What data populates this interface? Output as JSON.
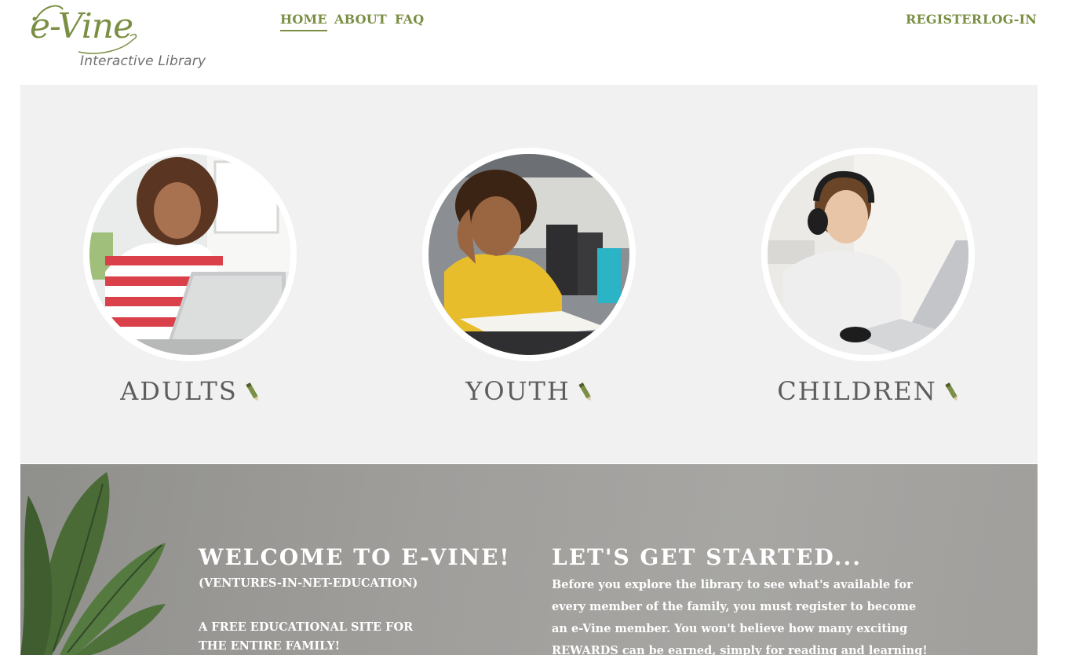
{
  "brand": {
    "logo_text": "e-Vine",
    "tagline": "Interactive Library",
    "accent_color": "#7a8f43"
  },
  "nav": {
    "home": "HOME",
    "about": "ABOUT",
    "faq": "FAQ",
    "register": "REGISTER",
    "login": "LOG-IN"
  },
  "categories": [
    {
      "title": "ADULTS",
      "icon": "pencil-icon"
    },
    {
      "title": "YOUTH",
      "icon": "pencil-icon"
    },
    {
      "title": "CHILDREN",
      "icon": "pencil-icon"
    }
  ],
  "welcome": {
    "title": "WELCOME TO E-VINE!",
    "subtitle": "(VENTURES-IN-NET-EDUCATION)",
    "tagline_line1": "A FREE EDUCATIONAL SITE FOR",
    "tagline_line2": "THE ENTIRE FAMILY!"
  },
  "started": {
    "title": "LET'S GET STARTED...",
    "lines": [
      "Before you explore the library to see what's available for",
      "every member of the family, you must register to become",
      "an e-Vine member. You won't believe how many exciting",
      "REWARDS can be earned, simply for reading and learning!"
    ]
  }
}
